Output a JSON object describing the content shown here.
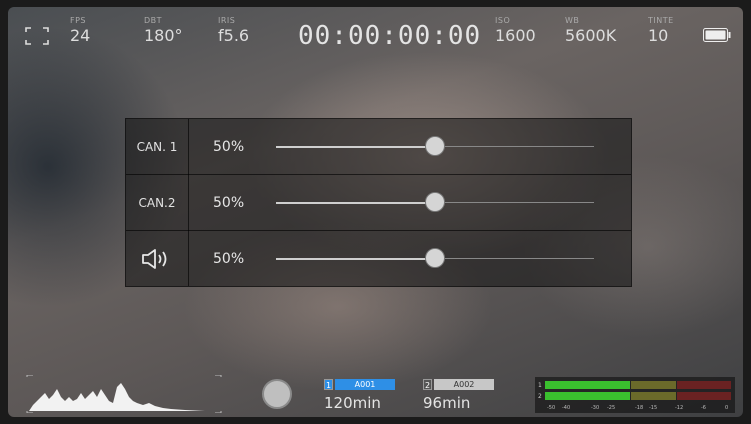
{
  "status": {
    "fps": {
      "label": "FPS",
      "value": "24"
    },
    "shutter": {
      "label": "DBT",
      "value": "180°"
    },
    "iris": {
      "label": "IRIS",
      "value": "f5.6"
    },
    "timecode": "00:00:00:00",
    "iso": {
      "label": "ISO",
      "value": "1600"
    },
    "wb": {
      "label": "WB",
      "value": "5600K"
    },
    "tint": {
      "label": "TINTE",
      "value": "10"
    }
  },
  "audio": {
    "rows": [
      {
        "name": "CAN. 1",
        "percent": "50%",
        "level": 0.5
      },
      {
        "name": "CAN.2",
        "percent": "50%",
        "level": 0.5
      },
      {
        "name": "",
        "icon": "speaker-icon",
        "percent": "50%",
        "level": 0.5
      }
    ]
  },
  "media": {
    "cards": [
      {
        "slot": "1",
        "name": "A001",
        "remaining": "120min",
        "active": true,
        "color": "#2e8fe6"
      },
      {
        "slot": "2",
        "name": "A002",
        "remaining": "96min",
        "active": false,
        "color": "#c7c7c7"
      }
    ]
  },
  "meters": {
    "channels": [
      "1",
      "2"
    ],
    "scale": [
      "-50",
      "-40",
      "-30",
      "-25",
      "-18",
      "-15",
      "-12",
      "-6",
      "0"
    ]
  },
  "colors": {
    "meter_green": "#3ac02e",
    "meter_yellow": "#6b6a2a",
    "meter_red": "#6a2222"
  }
}
